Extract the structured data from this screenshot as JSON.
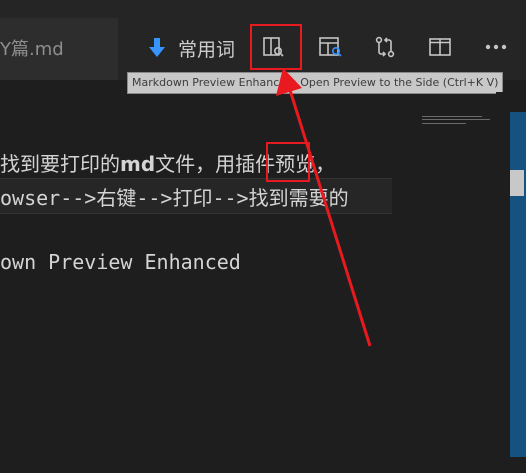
{
  "tab": {
    "label": "Y篇.md"
  },
  "breadcrumb": {
    "icon": "arrow-down-icon",
    "label": "常用词"
  },
  "toolbar": {
    "actions": [
      {
        "name": "open-preview-to-side",
        "icon": "preview-side-icon",
        "highlighted": true
      },
      {
        "name": "open-preview",
        "icon": "preview-search-icon"
      },
      {
        "name": "open-changes",
        "icon": "git-compare-icon"
      },
      {
        "name": "split-editor",
        "icon": "split-editor-icon"
      },
      {
        "name": "more-actions",
        "icon": "ellipsis-icon"
      }
    ]
  },
  "tooltip": {
    "text": "Markdown Preview Enhanced: Open Preview to the Side (Ctrl+K V)"
  },
  "editor": {
    "line1": {
      "before": "找到要打印的",
      "bold": "md",
      "middle": "文件，用",
      "highlighted": "插件",
      "after": "预览，"
    },
    "line2": "owser-->右键-->打印-->找到需要的",
    "line3": "own Preview Enhanced"
  },
  "colors": {
    "accent": "#e8191f",
    "scrollbar": "#15527f",
    "icon": "#c5c5c5",
    "arrowIcon": "#3794ff"
  }
}
